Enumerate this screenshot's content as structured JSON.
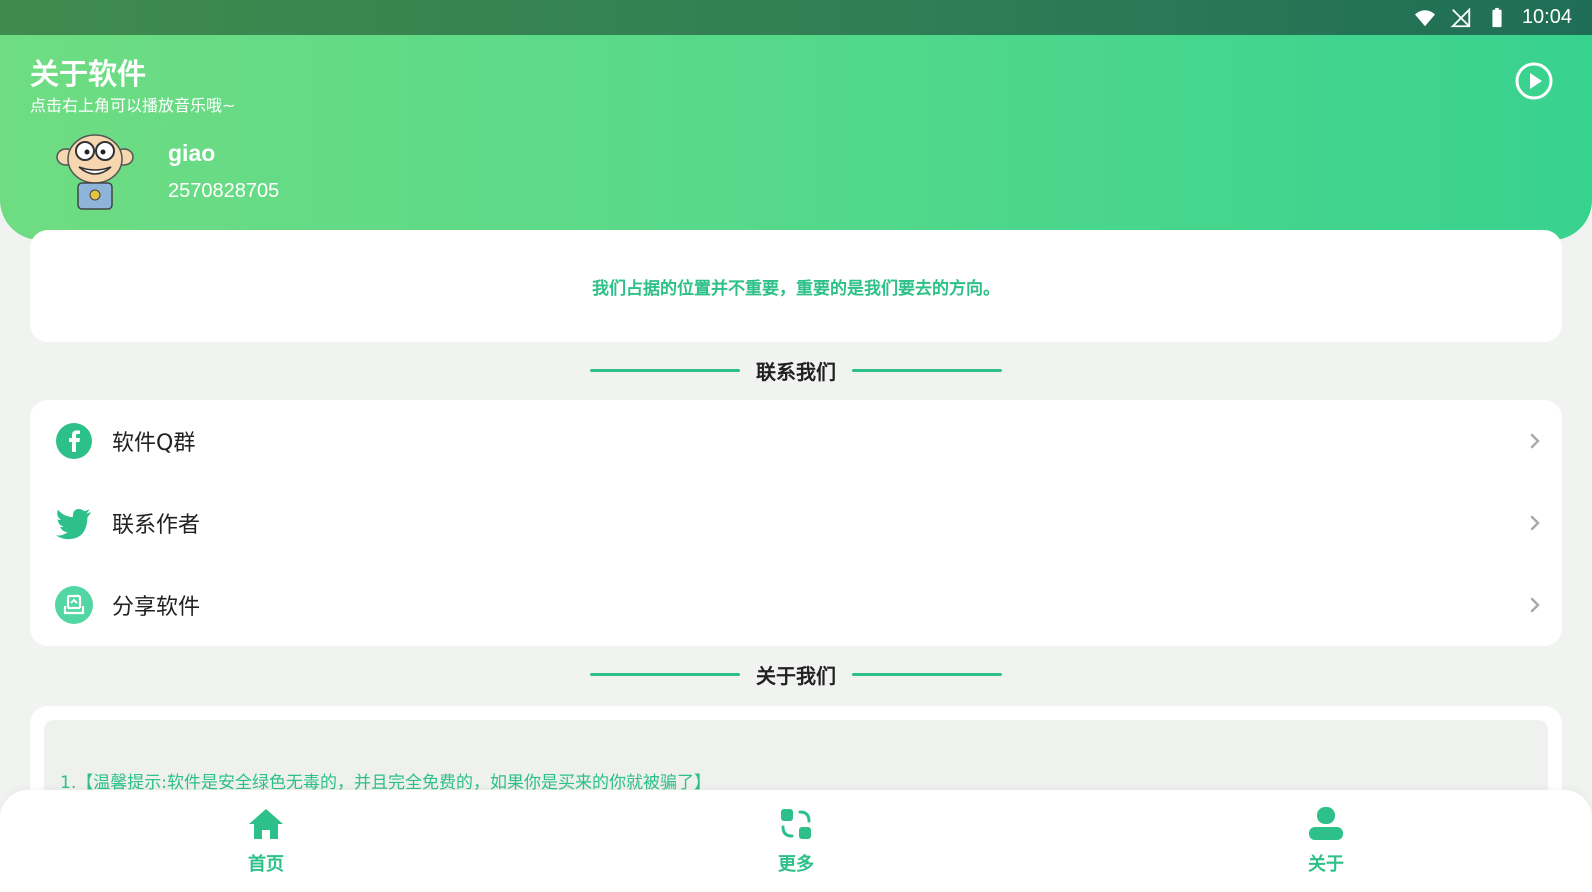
{
  "status_bar": {
    "time": "10:04"
  },
  "header": {
    "title": "关于软件",
    "subtitle": "点击右上角可以播放音乐哦~",
    "user": {
      "name": "giao",
      "id": "2570828705"
    }
  },
  "motto": "我们占据的位置并不重要，重要的是我们要去的方向。",
  "contact_section": {
    "title": "联系我们",
    "items": [
      {
        "label": "软件Q群",
        "icon": "facebook-icon"
      },
      {
        "label": "联系作者",
        "icon": "twitter-icon"
      },
      {
        "label": "分享软件",
        "icon": "share-icon"
      }
    ]
  },
  "about_section": {
    "title": "关于我们",
    "notes": [
      "1.【温馨提示:软件是安全绿色无毒的，并且完全免费的，如果你是买来的你就被骗了】"
    ]
  },
  "bottom_nav": {
    "items": [
      {
        "label": "首页",
        "icon": "home-icon"
      },
      {
        "label": "更多",
        "icon": "grid-more-icon"
      },
      {
        "label": "关于",
        "icon": "user-icon"
      }
    ]
  },
  "colors": {
    "accent": "#2ec08a",
    "header_start": "#6fdc82",
    "header_end": "#38d28f"
  }
}
